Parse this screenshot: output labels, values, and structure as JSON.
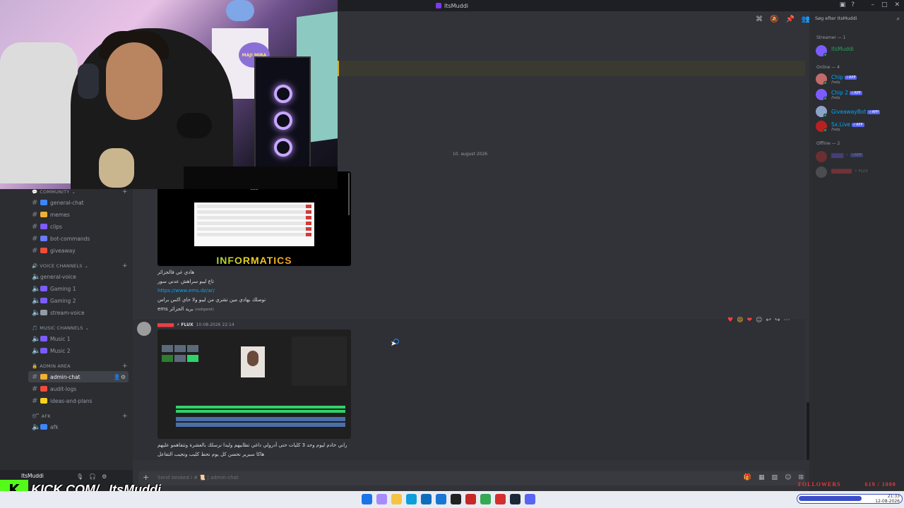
{
  "window": {
    "title": "ItsMuddi"
  },
  "webcam": {
    "sign_text": "MAJI\nMIRA"
  },
  "sidebar": {
    "categories": [
      {
        "label": "COMMUNITY"
      },
      {
        "label": "VOICE CHANNELS"
      },
      {
        "label": "MUSIC CHANNELS"
      },
      {
        "label": "ADMIN AREA"
      },
      {
        "label": "AFK"
      }
    ],
    "channels": [
      {
        "label": "general-chat"
      },
      {
        "label": "memes"
      },
      {
        "label": "clips"
      },
      {
        "label": "bot-commands"
      },
      {
        "label": "giveaway"
      },
      {
        "label": "general-voice"
      },
      {
        "label": "Gaming 1"
      },
      {
        "label": "Gaming 2"
      },
      {
        "label": "stream-voice"
      },
      {
        "label": "Music 1"
      },
      {
        "label": "Music 2"
      },
      {
        "label": "admin-chat"
      },
      {
        "label": "audit-logs"
      },
      {
        "label": "ideas-and-plans"
      },
      {
        "label": "afk"
      }
    ]
  },
  "userpanel": {
    "username": "ItsMuddi"
  },
  "overlay": {
    "kick_text": "KICK.COM/",
    "kick_name": "ItsMuddi",
    "followers_label": "FOLLOWERS",
    "followers_count": "619 / 1000"
  },
  "chat": {
    "date_divider": "10. august 2026",
    "image1_text": "INFORMATICS",
    "message1": {
      "line1": "هادي غي فالجزائر",
      "line2": "تاع ليبو سراهش عدني سور",
      "link": "https://www.ems.dz/ar/",
      "line4": "توصلك بهادي مين تشري من ليبو ولا حاي اكس براس",
      "line5": "ems بريد الجزائر",
      "edited": "(redigeret)"
    },
    "message2": {
      "tag": "⚡ FLUX",
      "time": "10-08-2026 22:14",
      "line1": "راني خادم ليوم وحد 3 كليات حتى أدرولي داغي تطابيهم وليدا نرسلك بالعشرة وتتفاهمو عليهم",
      "line2": "هاكا سيرير نحسن كل يوم نحط كليب ونجيب التفاعل"
    },
    "composer_placeholder": "Send besked i # 📜 | admin-chat"
  },
  "members": {
    "search_placeholder": "Søg efter ItsMuddi",
    "categories": {
      "streamer": "Streamer — 1",
      "online": "Online — 4",
      "offline": "Offline — 2"
    },
    "list": [
      {
        "name": "ItsMuddi",
        "sub": "",
        "color": "#23a55a",
        "app": false
      },
      {
        "name": "Chip",
        "sub": "/help",
        "color": "#00a8fc",
        "app": true
      },
      {
        "name": "Chip 2",
        "sub": "/help",
        "color": "#00a8fc",
        "app": true
      },
      {
        "name": "GiveawayBot",
        "sub": "",
        "color": "#00a8fc",
        "app": true
      },
      {
        "name": "Sx.Live",
        "sub": "/help",
        "color": "#00a8fc",
        "app": true
      }
    ],
    "offline_flux": "⚡ FLUX",
    "app_label": "✓APP"
  },
  "taskbar": {
    "time": "21:33",
    "date": "12-08-2026"
  },
  "colors": {
    "accent": "#5865f2",
    "kick_green": "#53fc18",
    "online": "#23a55a",
    "danger": "#f23f42"
  }
}
